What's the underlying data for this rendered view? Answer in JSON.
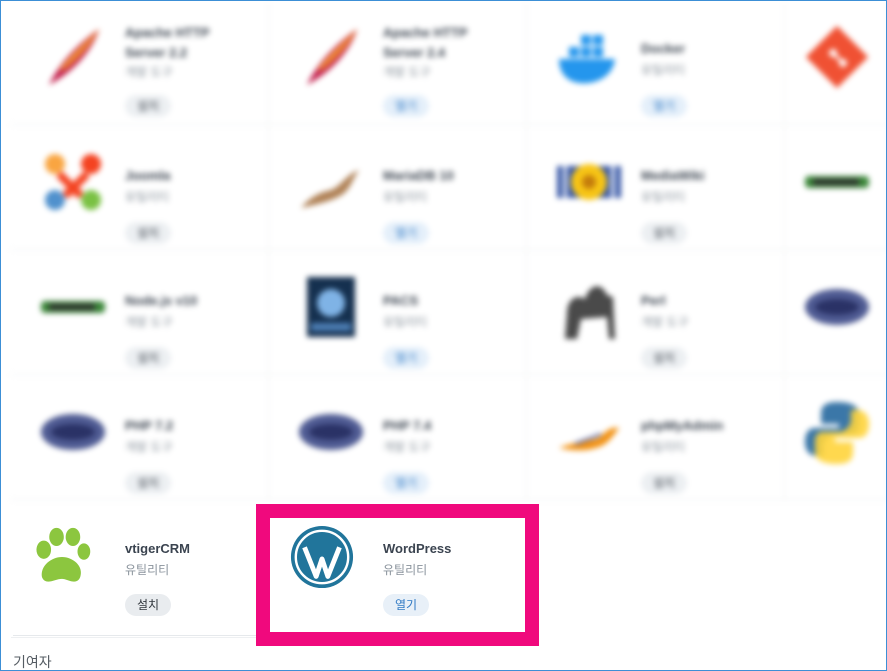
{
  "apps": [
    {
      "name": "Apache HTTP Server 2.2",
      "category": "개발 도구",
      "button": "설치",
      "icon": "apache-feather-icon"
    },
    {
      "name": "Apache HTTP Server 2.4",
      "category": "개발 도구",
      "button": "열기",
      "icon": "apache-feather-icon"
    },
    {
      "name": "Docker",
      "category": "유틸리티",
      "button": "열기",
      "icon": "docker-whale-icon"
    },
    {
      "name": "",
      "category": "",
      "button": "",
      "icon": "git-icon"
    },
    {
      "name": "Joomla",
      "category": "유틸리티",
      "button": "설치",
      "icon": "joomla-icon"
    },
    {
      "name": "MariaDB 10",
      "category": "유틸리티",
      "button": "열기",
      "icon": "mariadb-seal-icon"
    },
    {
      "name": "MediaWiki",
      "category": "유틸리티",
      "button": "설치",
      "icon": "mediawiki-sunflower-icon"
    },
    {
      "name": "",
      "category": "",
      "button": "",
      "icon": "nodejs-icon"
    },
    {
      "name": "Node.js v10",
      "category": "개발 도구",
      "button": "설치",
      "icon": "nodejs-icon"
    },
    {
      "name": "PACS",
      "category": "유틸리티",
      "button": "열기",
      "icon": "pacs-icon"
    },
    {
      "name": "Perl",
      "category": "개발 도구",
      "button": "설치",
      "icon": "perl-camel-icon"
    },
    {
      "name": "",
      "category": "",
      "button": "",
      "icon": "php-icon"
    },
    {
      "name": "PHP 7.2",
      "category": "개발 도구",
      "button": "설치",
      "icon": "php-icon"
    },
    {
      "name": "PHP 7.4",
      "category": "개발 도구",
      "button": "열기",
      "icon": "php-icon"
    },
    {
      "name": "phpMyAdmin",
      "category": "유틸리티",
      "button": "설치",
      "icon": "phpmyadmin-icon"
    },
    {
      "name": "",
      "category": "",
      "button": "",
      "icon": "python-icon"
    }
  ],
  "sharp_apps": [
    {
      "name": "vtigerCRM",
      "category": "유틸리티",
      "button": "설치",
      "icon": "paw-icon"
    },
    {
      "name": "WordPress",
      "category": "유틸리티",
      "button": "열기",
      "icon": "wordpress-icon"
    }
  ],
  "footer": {
    "label": "기여자"
  },
  "colors": {
    "highlight": "#f0097d",
    "open_button_text": "#2f79c4",
    "wordpress_blue": "#21759b",
    "paw_green": "#8cc63f"
  }
}
